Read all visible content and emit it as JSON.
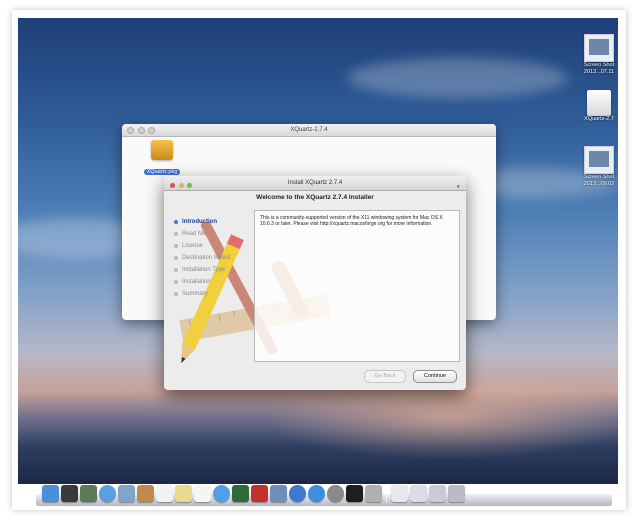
{
  "finder": {
    "title": "XQuartz-2.7.4",
    "file_label": "XQuartz.pkg"
  },
  "installer": {
    "title": "Install XQuartz 2.7.4",
    "heading": "Welcome to the XQuartz 2.7.4 Installer",
    "steps": [
      {
        "label": "Introduction",
        "active": true
      },
      {
        "label": "Read Me",
        "active": false
      },
      {
        "label": "License",
        "active": false
      },
      {
        "label": "Destination Select",
        "active": false
      },
      {
        "label": "Installation Type",
        "active": false
      },
      {
        "label": "Installation",
        "active": false
      },
      {
        "label": "Summary",
        "active": false
      }
    ],
    "body_text": "This is a community-supported version of the X11 windowing system for Mac OS X 10.6.3 or later.  Please visit http://xquartz.macosforge.org for more information.",
    "go_back_label": "Go Back",
    "continue_label": "Continue"
  },
  "desktop_icons": [
    {
      "label_line1": "Screen Shot",
      "label_line2": "2013...07.11",
      "icon": "screenshot-file-icon"
    },
    {
      "label_line1": "XQuartz-2.7",
      "label_line2": "",
      "icon": "disk-image-icon"
    },
    {
      "label_line1": "Screen Shot",
      "label_line2": "2013...09.02",
      "icon": "screenshot-file-icon"
    }
  ],
  "dock_items": [
    {
      "name": "finder",
      "color": "#4a8fd8"
    },
    {
      "name": "dashboard",
      "color": "#3a3a3a"
    },
    {
      "name": "mission-control",
      "color": "#5b7a5a"
    },
    {
      "name": "safari",
      "color": "#5aa0e0"
    },
    {
      "name": "mail",
      "color": "#7fa6c9"
    },
    {
      "name": "contacts",
      "color": "#c08a4a"
    },
    {
      "name": "calendar",
      "color": "#f2f2f2"
    },
    {
      "name": "notes",
      "color": "#e8d98c"
    },
    {
      "name": "reminders",
      "color": "#f5f5f5"
    },
    {
      "name": "messages",
      "color": "#4fa0e8"
    },
    {
      "name": "facetime",
      "color": "#2d6b3a"
    },
    {
      "name": "photo-booth",
      "color": "#c0322a"
    },
    {
      "name": "iphoto",
      "color": "#6d8fb5"
    },
    {
      "name": "itunes",
      "color": "#3c7ad1"
    },
    {
      "name": "app-store",
      "color": "#3b8ee0"
    },
    {
      "name": "system-preferences",
      "color": "#8a8a8a"
    },
    {
      "name": "terminal",
      "color": "#1e1e1e"
    },
    {
      "name": "x11",
      "color": "#b0b0b0"
    },
    {
      "name": "sep",
      "color": ""
    },
    {
      "name": "documents",
      "color": "#e8e8ec"
    },
    {
      "name": "downloads",
      "color": "#d8dde6"
    },
    {
      "name": "file-stack",
      "color": "#c8ccd4"
    },
    {
      "name": "trash",
      "color": "#b9bcc4"
    }
  ]
}
